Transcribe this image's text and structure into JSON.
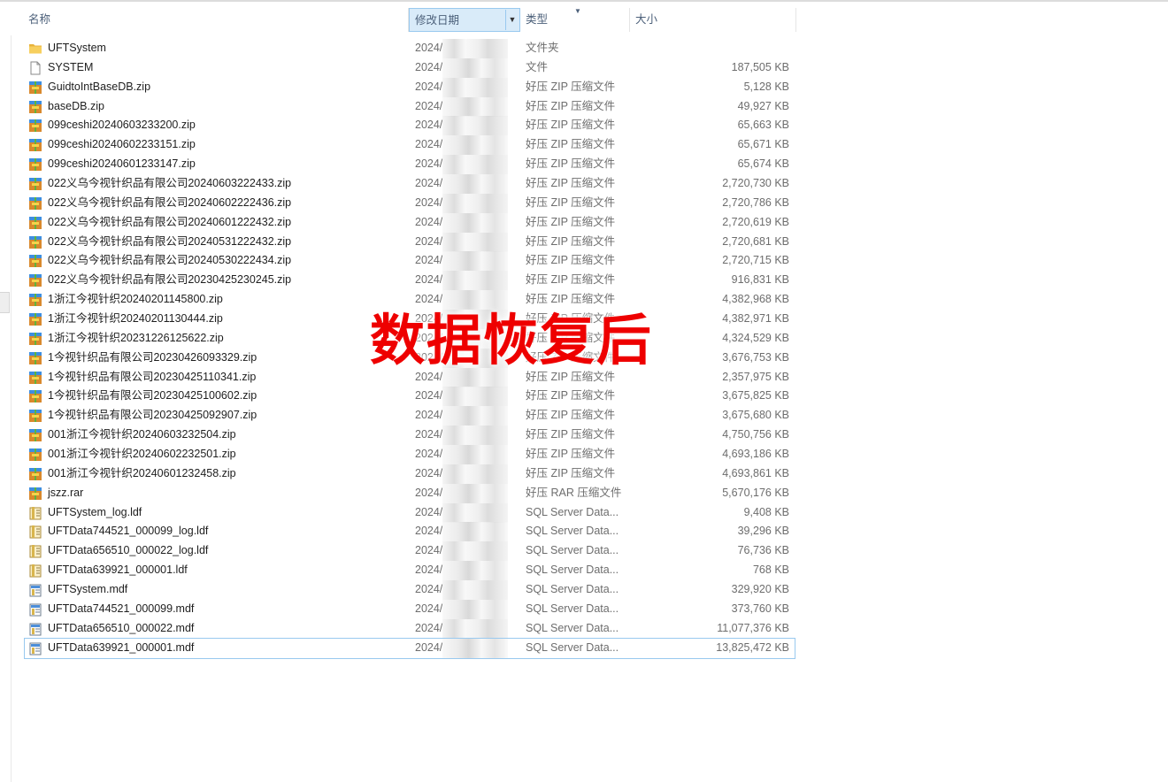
{
  "header": {
    "name": "名称",
    "date": "修改日期",
    "type": "类型",
    "size": "大小"
  },
  "watermark": "数据恢复后",
  "colors": {
    "header_selected": "#d9ebf9",
    "header_border": "#99c9ef",
    "watermark": "#ee0000",
    "header_text": "#4c607a"
  },
  "files": [
    {
      "name": "UFTSystem",
      "date": "2024/",
      "type": "文件夹",
      "size": "",
      "icon": "folder-icon"
    },
    {
      "name": "SYSTEM",
      "date": "2024/",
      "type": "文件",
      "size": "187,505 KB",
      "icon": "file-icon"
    },
    {
      "name": "GuidtoIntBaseDB.zip",
      "date": "2024/",
      "type": "好压 ZIP 压缩文件",
      "size": "5,128 KB",
      "icon": "archive-icon"
    },
    {
      "name": "baseDB.zip",
      "date": "2024/",
      "type": "好压 ZIP 压缩文件",
      "size": "49,927 KB",
      "icon": "archive-icon"
    },
    {
      "name": "099ceshi20240603233200.zip",
      "date": "2024/",
      "type": "好压 ZIP 压缩文件",
      "size": "65,663 KB",
      "icon": "archive-icon"
    },
    {
      "name": "099ceshi20240602233151.zip",
      "date": "2024/",
      "type": "好压 ZIP 压缩文件",
      "size": "65,671 KB",
      "icon": "archive-icon"
    },
    {
      "name": "099ceshi20240601233147.zip",
      "date": "2024/",
      "type": "好压 ZIP 压缩文件",
      "size": "65,674 KB",
      "icon": "archive-icon"
    },
    {
      "name": "022义乌今视针织品有限公司20240603222433.zip",
      "date": "2024/",
      "type": "好压 ZIP 压缩文件",
      "size": "2,720,730 KB",
      "icon": "archive-icon"
    },
    {
      "name": "022义乌今视针织品有限公司20240602222436.zip",
      "date": "2024/",
      "type": "好压 ZIP 压缩文件",
      "size": "2,720,786 KB",
      "icon": "archive-icon"
    },
    {
      "name": "022义乌今视针织品有限公司20240601222432.zip",
      "date": "2024/",
      "type": "好压 ZIP 压缩文件",
      "size": "2,720,619 KB",
      "icon": "archive-icon"
    },
    {
      "name": "022义乌今视针织品有限公司20240531222432.zip",
      "date": "2024/",
      "type": "好压 ZIP 压缩文件",
      "size": "2,720,681 KB",
      "icon": "archive-icon"
    },
    {
      "name": "022义乌今视针织品有限公司20240530222434.zip",
      "date": "2024/",
      "type": "好压 ZIP 压缩文件",
      "size": "2,720,715 KB",
      "icon": "archive-icon"
    },
    {
      "name": "022义乌今视针织品有限公司20230425230245.zip",
      "date": "2024/",
      "type": "好压 ZIP 压缩文件",
      "size": "916,831 KB",
      "icon": "archive-icon"
    },
    {
      "name": "1浙江今视针织20240201145800.zip",
      "date": "2024/",
      "type": "好压 ZIP 压缩文件",
      "size": "4,382,968 KB",
      "icon": "archive-icon"
    },
    {
      "name": "1浙江今视针织20240201130444.zip",
      "date": "2024/",
      "type": "好压 ZIP 压缩文件",
      "size": "4,382,971 KB",
      "icon": "archive-icon"
    },
    {
      "name": "1浙江今视针织20231226125622.zip",
      "date": "2024/",
      "type": "好压 ZIP 压缩文件",
      "size": "4,324,529 KB",
      "icon": "archive-icon"
    },
    {
      "name": "1今视针织品有限公司20230426093329.zip",
      "date": "2024/",
      "type": "好压 ZIP 压缩文件",
      "size": "3,676,753 KB",
      "icon": "archive-icon"
    },
    {
      "name": "1今视针织品有限公司20230425110341.zip",
      "date": "2024/",
      "type": "好压 ZIP 压缩文件",
      "size": "2,357,975 KB",
      "icon": "archive-icon"
    },
    {
      "name": "1今视针织品有限公司20230425100602.zip",
      "date": "2024/",
      "type": "好压 ZIP 压缩文件",
      "size": "3,675,825 KB",
      "icon": "archive-icon"
    },
    {
      "name": "1今视针织品有限公司20230425092907.zip",
      "date": "2024/",
      "type": "好压 ZIP 压缩文件",
      "size": "3,675,680 KB",
      "icon": "archive-icon"
    },
    {
      "name": "001浙江今视针织20240603232504.zip",
      "date": "2024/",
      "type": "好压 ZIP 压缩文件",
      "size": "4,750,756 KB",
      "icon": "archive-icon"
    },
    {
      "name": "001浙江今视针织20240602232501.zip",
      "date": "2024/",
      "type": "好压 ZIP 压缩文件",
      "size": "4,693,186 KB",
      "icon": "archive-icon"
    },
    {
      "name": "001浙江今视针织20240601232458.zip",
      "date": "2024/",
      "type": "好压 ZIP 压缩文件",
      "size": "4,693,861 KB",
      "icon": "archive-icon"
    },
    {
      "name": "jszz.rar",
      "date": "2024/",
      "type": "好压 RAR 压缩文件",
      "size": "5,670,176 KB",
      "icon": "archive-icon"
    },
    {
      "name": "UFTSystem_log.ldf",
      "date": "2024/",
      "type": "SQL Server Data...",
      "size": "9,408 KB",
      "icon": "ldf-icon"
    },
    {
      "name": "UFTData744521_000099_log.ldf",
      "date": "2024/",
      "type": "SQL Server Data...",
      "size": "39,296 KB",
      "icon": "ldf-icon"
    },
    {
      "name": "UFTData656510_000022_log.ldf",
      "date": "2024/",
      "type": "SQL Server Data...",
      "size": "76,736 KB",
      "icon": "ldf-icon"
    },
    {
      "name": "UFTData639921_000001.ldf",
      "date": "2024/",
      "type": "SQL Server Data...",
      "size": "768 KB",
      "icon": "ldf-icon"
    },
    {
      "name": "UFTSystem.mdf",
      "date": "2024/",
      "type": "SQL Server Data...",
      "size": "329,920 KB",
      "icon": "mdf-icon"
    },
    {
      "name": "UFTData744521_000099.mdf",
      "date": "2024/",
      "type": "SQL Server Data...",
      "size": "373,760 KB",
      "icon": "mdf-icon"
    },
    {
      "name": "UFTData656510_000022.mdf",
      "date": "2024/",
      "type": "SQL Server Data...",
      "size": "11,077,376 KB",
      "icon": "mdf-icon"
    },
    {
      "name": "UFTData639921_000001.mdf",
      "date": "2024/",
      "type": "SQL Server Data...",
      "size": "13,825,472 KB",
      "icon": "mdf-icon",
      "selected": true
    }
  ]
}
